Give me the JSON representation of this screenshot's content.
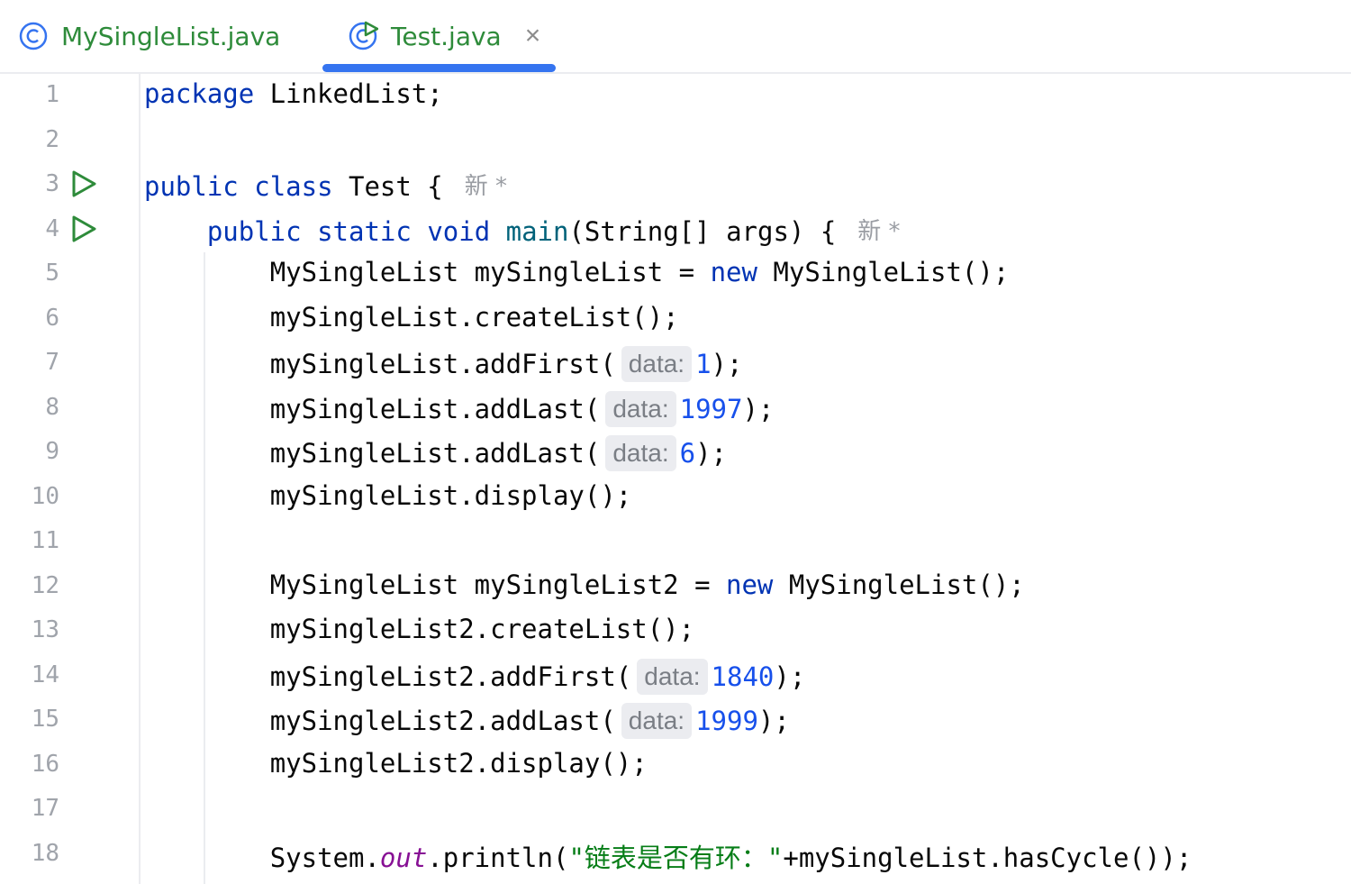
{
  "tabs": [
    {
      "label": "MySingleList.java",
      "icon": "java-class-icon",
      "active": false
    },
    {
      "label": "Test.java",
      "icon": "java-class-run-icon",
      "active": true,
      "close": "×"
    }
  ],
  "colors": {
    "accent": "#3574f0",
    "tab_text": "#2e8b3a",
    "keyword": "#0033b3",
    "number": "#1750eb",
    "string": "#067d17"
  },
  "editor": {
    "line_numbers": [
      "1",
      "2",
      "3",
      "4",
      "5",
      "6",
      "7",
      "8",
      "9",
      "10",
      "11",
      "12",
      "13",
      "14",
      "15",
      "16",
      "17",
      "18"
    ],
    "new_marker": "新 *",
    "hint_label": "data:",
    "lines": {
      "l1": {
        "kw": "package",
        "rest": " LinkedList;"
      },
      "l3": {
        "kw1": "public",
        "kw2": "class",
        "rest": " Test {"
      },
      "l4": {
        "kw1": "public",
        "kw2": "static",
        "kw3": "void",
        "fn": "main",
        "rest": "(String[] args) {"
      },
      "l5": {
        "a": "MySingleList mySingleList = ",
        "kw": "new",
        "b": " MySingleList();"
      },
      "l6": {
        "a": "mySingleList.createList();"
      },
      "l7": {
        "a": "mySingleList.addFirst(",
        "num": "1",
        "b": ");"
      },
      "l8": {
        "a": "mySingleList.addLast(",
        "num": "1997",
        "b": ");"
      },
      "l9": {
        "a": "mySingleList.addLast(",
        "num": "6",
        "b": ");"
      },
      "l10": {
        "a": "mySingleList.display();"
      },
      "l12": {
        "a": "MySingleList mySingleList2 = ",
        "kw": "new",
        "b": " MySingleList();"
      },
      "l13": {
        "a": "mySingleList2.createList();"
      },
      "l14": {
        "a": "mySingleList2.addFirst(",
        "num": "1840",
        "b": ");"
      },
      "l15": {
        "a": "mySingleList2.addLast(",
        "num": "1999",
        "b": ");"
      },
      "l16": {
        "a": "mySingleList2.display();"
      },
      "l18": {
        "a": "System.",
        "fld": "out",
        "b": ".println(",
        "str": "\"链表是否有环：\"",
        "c": "+mySingleList.hasCycle());"
      }
    }
  }
}
